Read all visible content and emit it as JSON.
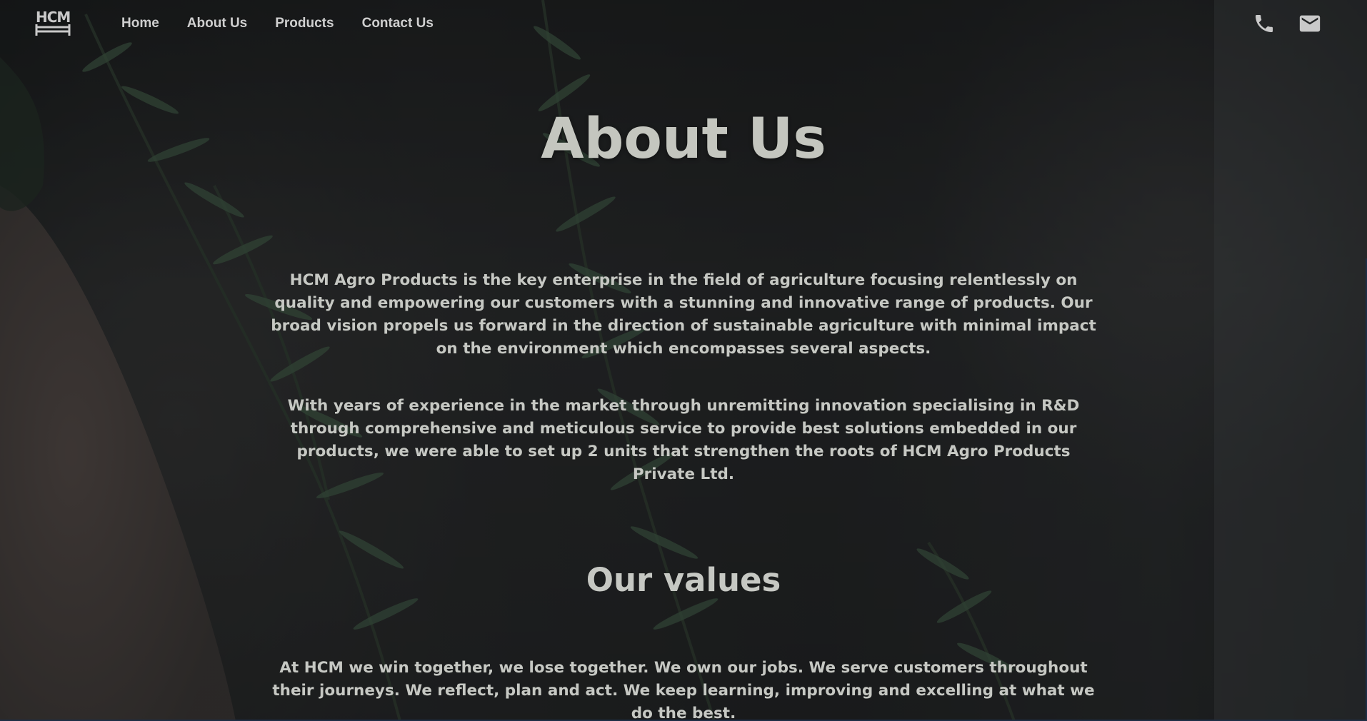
{
  "nav": {
    "logo_text": "HCM",
    "links": [
      {
        "label": "Home"
      },
      {
        "label": "About Us"
      },
      {
        "label": "Products"
      },
      {
        "label": "Contact Us"
      }
    ],
    "icons": [
      "phone-icon",
      "mail-icon"
    ]
  },
  "hero": {
    "title": "About Us"
  },
  "about": {
    "paragraph_1": "HCM Agro Products is the key enterprise in the field of agriculture focusing relentlessly on quality and empowering our customers with a stunning and innovative range of products. Our broad vision propels us forward in the direction of sustainable agriculture with minimal impact on the environment which encompasses several aspects.",
    "paragraph_2": "With years of experience in the market through unremitting innovation specialising in R&D through comprehensive and meticulous service to provide best solutions embedded in our products, we were able to set up 2 units that strengthen the roots of HCM Agro Products Private Ltd."
  },
  "values": {
    "title": "Our values",
    "paragraph": "At HCM we win together, we lose together. We own our jobs. We serve customers throughout their journeys. We reflect, plan and act. We keep learning, improving and excelling at what we do the best."
  },
  "colors": {
    "text": "#c6c8c3",
    "nav_text": "#cfcfcf",
    "background": "#2f3131"
  }
}
